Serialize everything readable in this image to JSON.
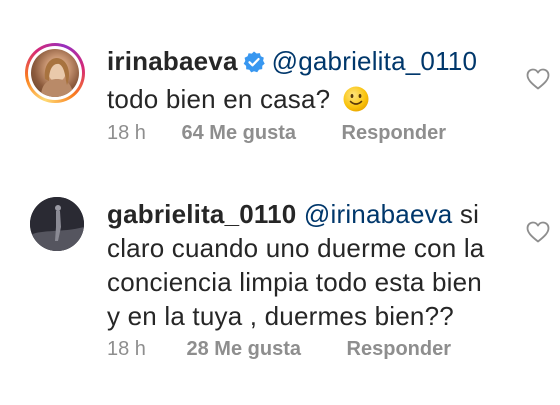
{
  "comments": [
    {
      "username": "irinabaeva",
      "verified": true,
      "mention": "@gabrielita_0110",
      "text_lines": [
        "todo bien en casa?"
      ],
      "emoji": "slightly-smiling-face",
      "time": "18 h",
      "likes": "64 Me gusta",
      "reply": "Responder"
    },
    {
      "username": "gabrielita_0110",
      "verified": false,
      "mention": "@irinabaeva",
      "first_line_suffix": "si",
      "text_lines": [
        "claro cuando uno duerme con la",
        "conciencia limpia todo esta bien",
        "y en la tuya , duermes bien??"
      ],
      "time": "18 h",
      "likes": "28 Me gusta",
      "reply": "Responder"
    }
  ],
  "icons": {
    "verified": "verified-badge-icon",
    "like": "heart-icon",
    "emoji": "smiley-icon"
  },
  "colors": {
    "username": "#262626",
    "mention": "#00376b",
    "meta": "#8e8e8e",
    "verified": "#3897f0",
    "emoji": "#f9c20a"
  }
}
